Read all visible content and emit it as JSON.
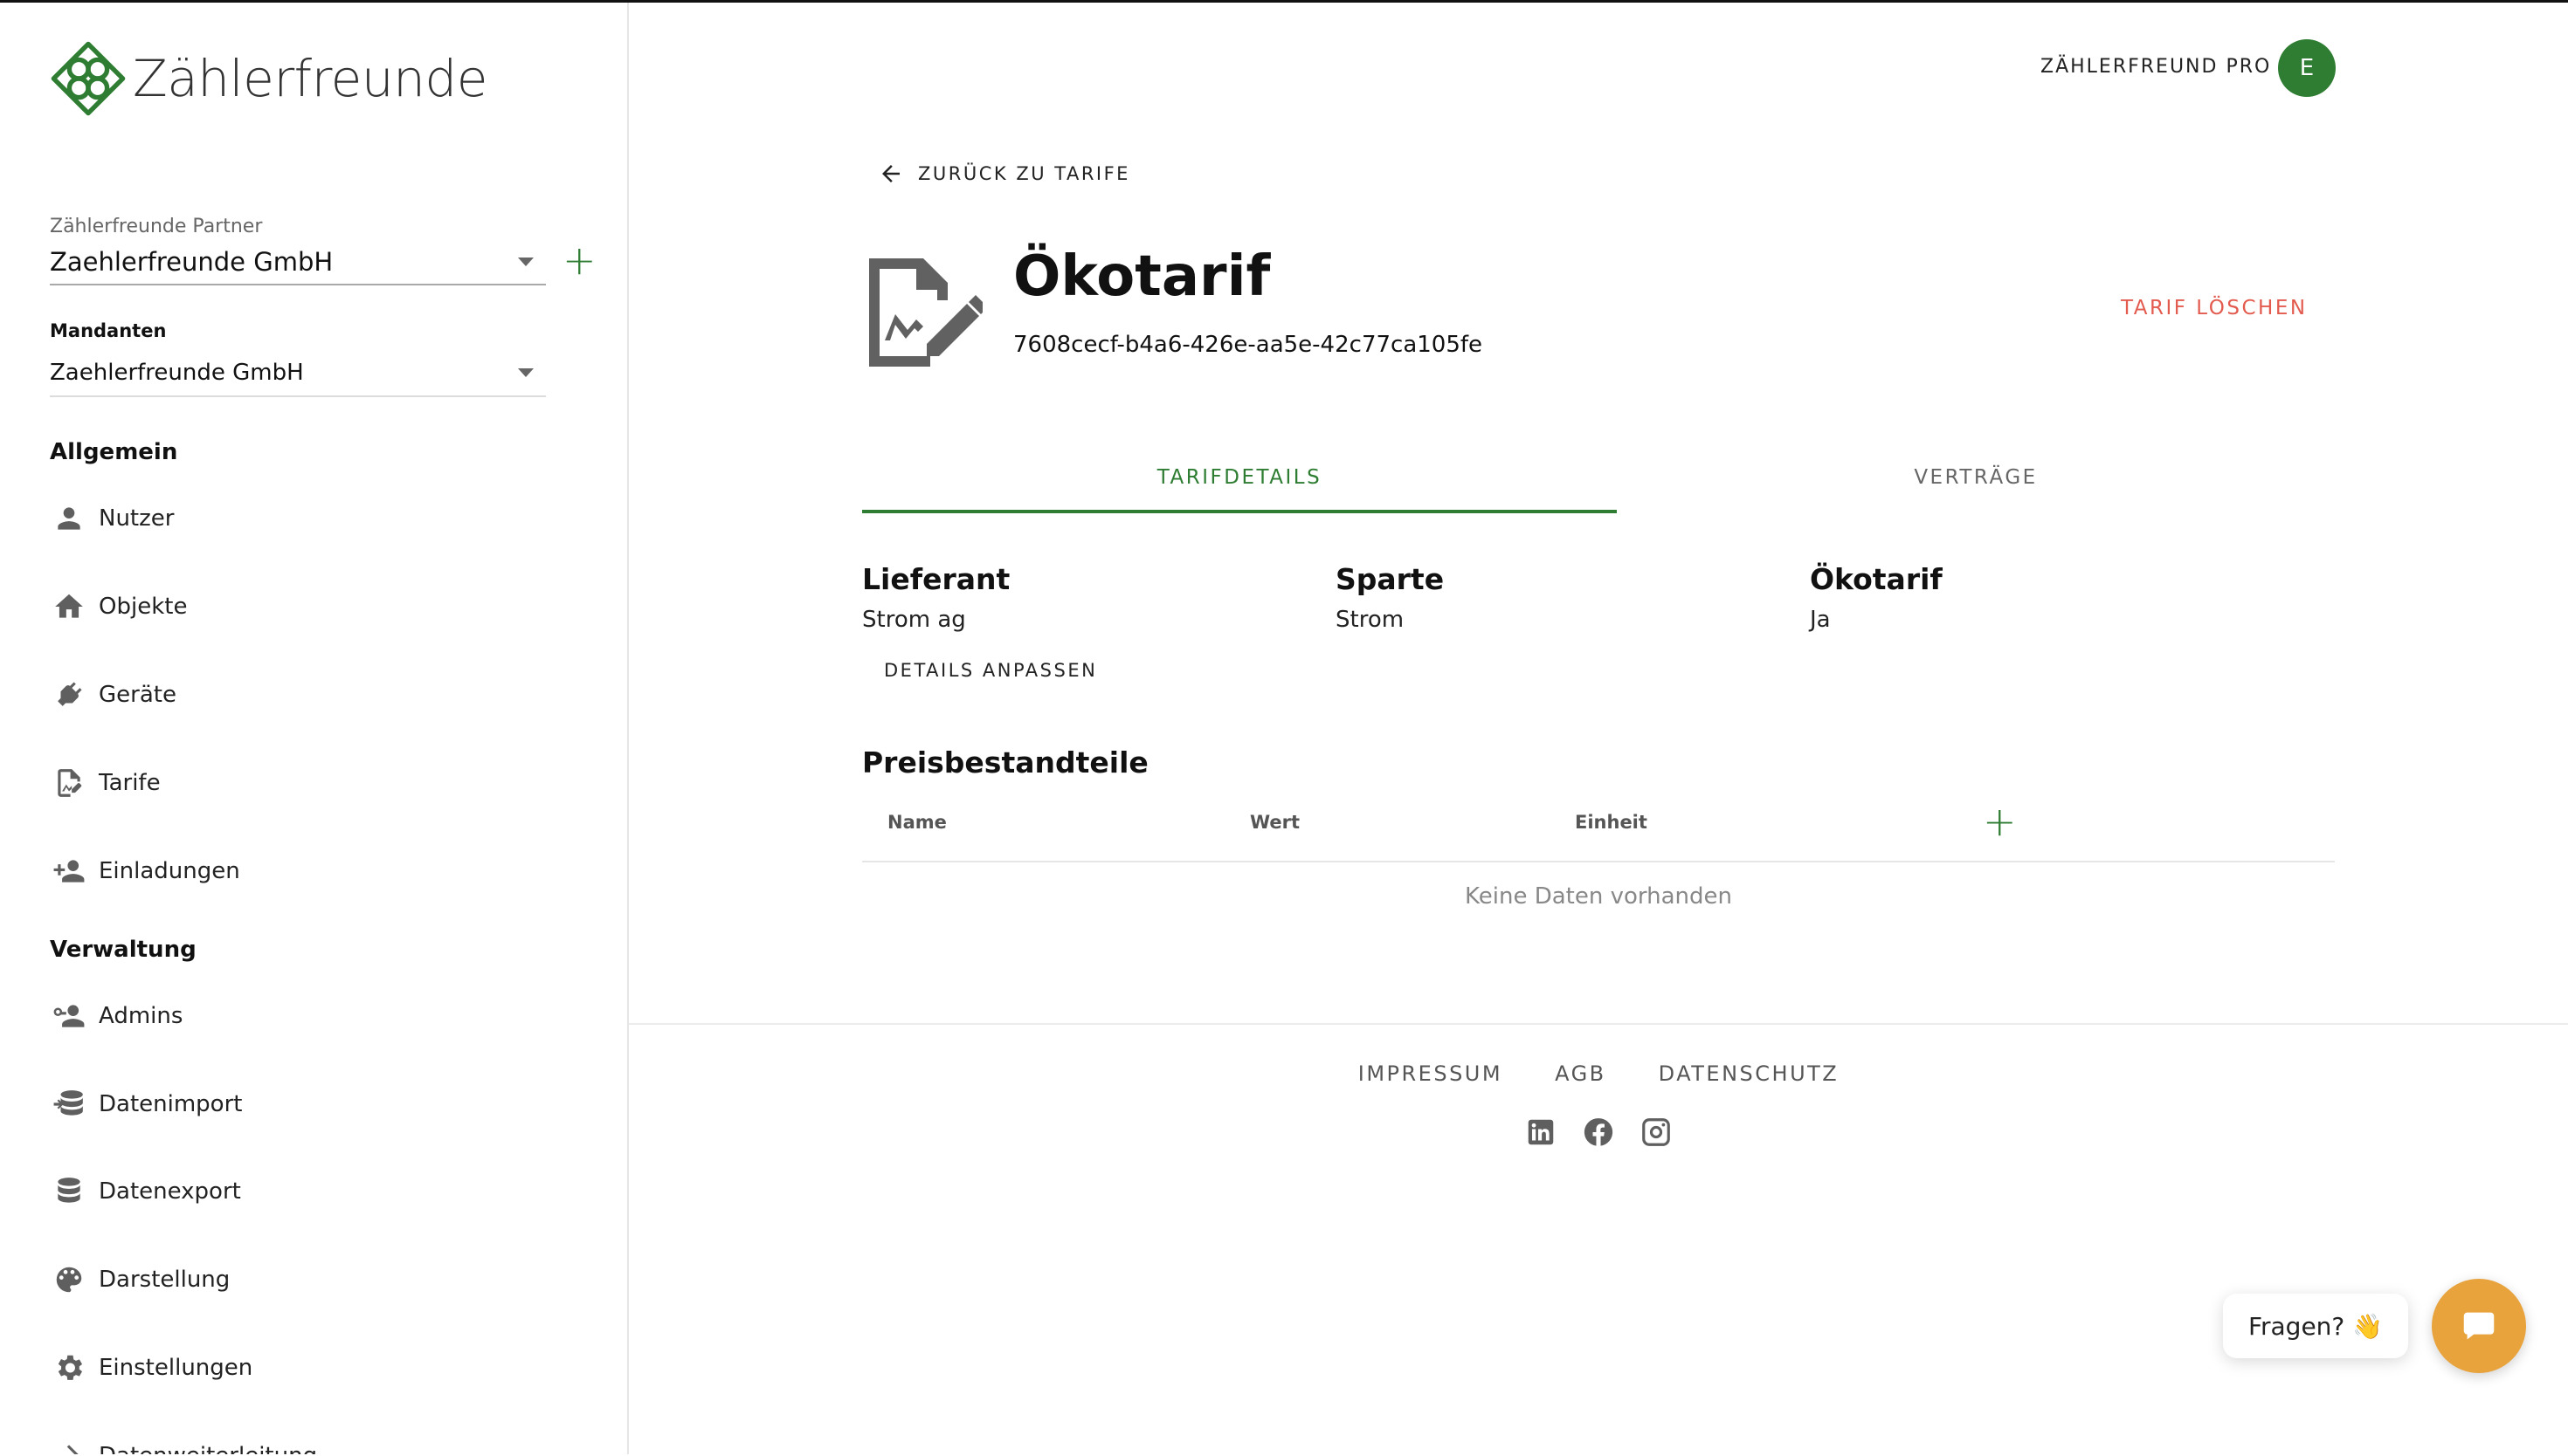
{
  "brand": {
    "name": "Zählerfreunde"
  },
  "sidebar": {
    "partner_label": "Zählerfreunde Partner",
    "partner_value": "Zaehlerfreunde GmbH",
    "mandanten_label": "Mandanten",
    "mandanten_value": "Zaehlerfreunde GmbH",
    "section_general": "Allgemein",
    "general_items": [
      {
        "label": "Nutzer",
        "icon": "person-icon"
      },
      {
        "label": "Objekte",
        "icon": "home-icon"
      },
      {
        "label": "Geräte",
        "icon": "plug-icon"
      },
      {
        "label": "Tarife",
        "icon": "tariff-icon"
      },
      {
        "label": "Einladungen",
        "icon": "invite-icon"
      }
    ],
    "section_admin": "Verwaltung",
    "admin_items": [
      {
        "label": "Admins",
        "icon": "admin-key-icon"
      },
      {
        "label": "Datenimport",
        "icon": "database-import-icon"
      },
      {
        "label": "Datenexport",
        "icon": "database-export-icon"
      },
      {
        "label": "Darstellung",
        "icon": "palette-icon"
      },
      {
        "label": "Einstellungen",
        "icon": "gear-icon"
      },
      {
        "label": "Datenweiterleitung",
        "icon": "forward-icon"
      }
    ]
  },
  "header": {
    "pro_label": "ZÄHLERFREUND PRO",
    "avatar_initial": "E",
    "accent": "#2e7d32"
  },
  "main": {
    "back_label": "ZURÜCK ZU TARIFE",
    "title": "Ökotarif",
    "id": "7608cecf-b4a6-426e-aa5e-42c77ca105fe",
    "delete_label": "TARIF LÖSCHEN",
    "tabs": [
      {
        "label": "TARIFDETAILS",
        "active": true
      },
      {
        "label": "VERTRÄGE",
        "active": false
      }
    ],
    "details": [
      {
        "heading": "Lieferant",
        "value": "Strom ag"
      },
      {
        "heading": "Sparte",
        "value": "Strom"
      },
      {
        "heading": "Ökotarif",
        "value": "Ja"
      }
    ],
    "details_button": "DETAILS ANPASSEN",
    "price_section_title": "Preisbestandteile",
    "table_columns": [
      "Name",
      "Wert",
      "Einheit"
    ],
    "empty_text": "Keine Daten vorhanden"
  },
  "footer": {
    "links": [
      "IMPRESSUM",
      "AGB",
      "DATENSCHUTZ"
    ],
    "socials": [
      "linkedin-icon",
      "facebook-icon",
      "instagram-icon"
    ]
  },
  "chat": {
    "bubble_text": "Fragen? 👋",
    "button_icon": "chat-icon",
    "button_color": "#e8a33c"
  }
}
